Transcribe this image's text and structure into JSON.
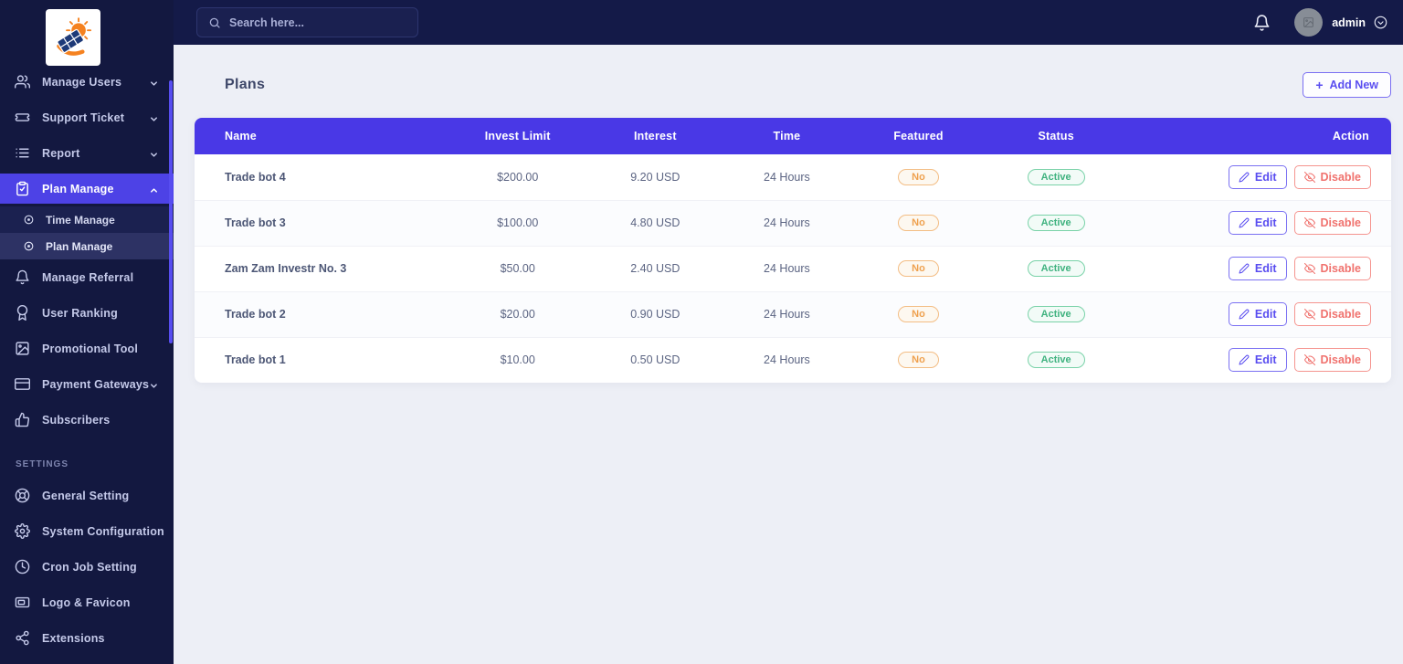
{
  "colors": {
    "accent_indigo": "#4938e6",
    "sidebar_navy": "#131840",
    "active_item_indigo": "#4d42e6",
    "success_green": "#3fb27f",
    "warning_orange": "#efa14f",
    "danger_red": "#f0726e",
    "page_background": "#edeff6"
  },
  "topbar": {
    "search_placeholder": "Search here...",
    "username": "admin",
    "icons": [
      "search-icon",
      "bell-icon",
      "avatar",
      "chevron-down-circle-icon"
    ]
  },
  "sidebar": {
    "items": [
      {
        "label": "Manage Users",
        "icon": "users-icon",
        "chevron": "down"
      },
      {
        "label": "Support Ticket",
        "icon": "ticket-icon",
        "chevron": "down"
      },
      {
        "label": "Report",
        "icon": "report-list-icon",
        "chevron": "down"
      },
      {
        "label": "Plan Manage",
        "icon": "clipboard-check-icon",
        "chevron": "up",
        "active": true
      },
      {
        "label": "Time Manage",
        "icon": "circle-dot-icon",
        "submenu": true
      },
      {
        "label": "Plan Manage",
        "icon": "circle-dot-icon",
        "submenu": true,
        "selected": true
      },
      {
        "label": "Manage Referral",
        "icon": "bell-icon"
      },
      {
        "label": "User Ranking",
        "icon": "medal-icon"
      },
      {
        "label": "Promotional Tool",
        "icon": "image-icon"
      },
      {
        "label": "Payment Gateways",
        "icon": "credit-card-icon",
        "chevron": "down"
      },
      {
        "label": "Subscribers",
        "icon": "thumbs-up-icon"
      }
    ],
    "section_label": "SETTINGS",
    "settings_items": [
      {
        "label": "General Setting",
        "icon": "life-ring-icon"
      },
      {
        "label": "System Configuration",
        "icon": "gear-icon"
      },
      {
        "label": "Cron Job Setting",
        "icon": "clock-icon"
      },
      {
        "label": "Logo & Favicon",
        "icon": "logo-image-icon"
      },
      {
        "label": "Extensions",
        "icon": "share-nodes-icon"
      }
    ]
  },
  "page": {
    "title": "Plans",
    "add_new": {
      "icon": "+",
      "label": "Add New"
    }
  },
  "table": {
    "headers": [
      "Name",
      "Invest Limit",
      "Interest",
      "Time",
      "Featured",
      "Status",
      "Action"
    ],
    "rows": [
      {
        "name": "Trade bot 4",
        "invest_limit": "$200.00",
        "interest": "9.20 USD",
        "time": "24 Hours",
        "featured": "No",
        "status": "Active"
      },
      {
        "name": "Trade bot 3",
        "invest_limit": "$100.00",
        "interest": "4.80 USD",
        "time": "24 Hours",
        "featured": "No",
        "status": "Active"
      },
      {
        "name": "Zam Zam Investr No. 3",
        "invest_limit": "$50.00",
        "interest": "2.40 USD",
        "time": "24 Hours",
        "featured": "No",
        "status": "Active"
      },
      {
        "name": "Trade bot 2",
        "invest_limit": "$20.00",
        "interest": "0.90 USD",
        "time": "24 Hours",
        "featured": "No",
        "status": "Active"
      },
      {
        "name": "Trade bot 1",
        "invest_limit": "$10.00",
        "interest": "0.50 USD",
        "time": "24 Hours",
        "featured": "No",
        "status": "Active"
      }
    ],
    "actions": {
      "edit": "Edit",
      "disable": "Disable"
    }
  }
}
